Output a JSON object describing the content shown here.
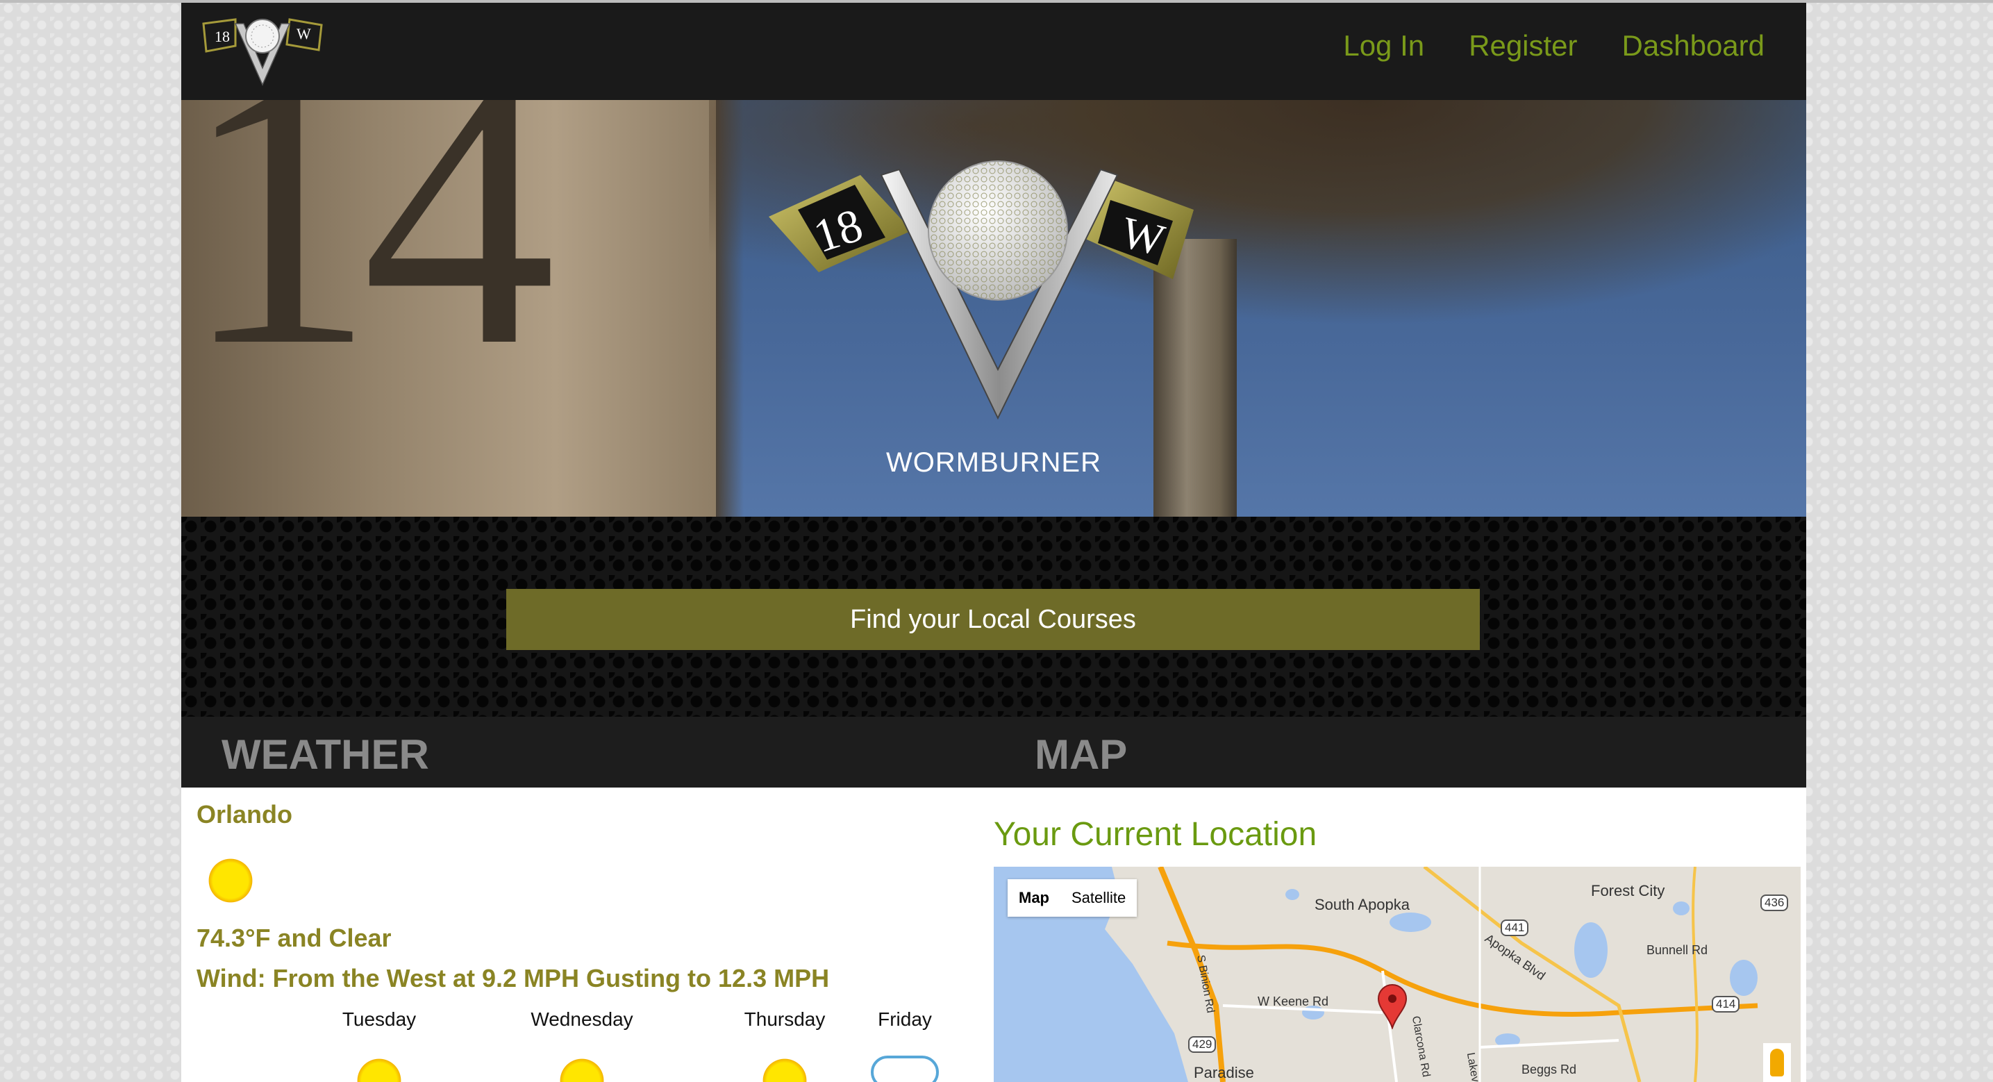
{
  "nav": {
    "links": [
      "Log In",
      "Register",
      "Dashboard"
    ]
  },
  "hero": {
    "brand": "WORMBURNER",
    "wall_number": "14",
    "logo_left_flag": "18",
    "logo_right_flag": "W"
  },
  "find_button": "Find your Local Courses",
  "sections": {
    "weather_title": "WEATHER",
    "map_title": "MAP"
  },
  "weather": {
    "city": "Orlando",
    "current_icon": "sun-icon",
    "temp": "74.3°F and Clear",
    "wind": "Wind: From the West at 9.2 MPH Gusting to 12.3 MPH",
    "forecast": [
      {
        "day": "Tuesday",
        "icon": "sun-icon"
      },
      {
        "day": "Wednesday",
        "icon": "sun-icon"
      },
      {
        "day": "Thursday",
        "icon": "sun-icon"
      },
      {
        "day": "Friday",
        "icon": "cloud-icon"
      }
    ]
  },
  "map": {
    "title": "Your Current Location",
    "type_map": "Map",
    "type_satellite": "Satellite",
    "labels": [
      "South Apopka",
      "Forest City",
      "Apopka Blvd",
      "Bunnell Rd",
      "W Keene Rd",
      "S Binion Rd",
      "Paradise",
      "Beggs Rd",
      "Clarcona Rd",
      "Lakev"
    ],
    "shields": [
      "441",
      "436",
      "414",
      "429"
    ]
  },
  "colors": {
    "accent_green": "#7a9a1a",
    "button_olive": "#6e6b28",
    "weather_text": "#8a8424",
    "nav_bg": "#1a1a1a"
  }
}
